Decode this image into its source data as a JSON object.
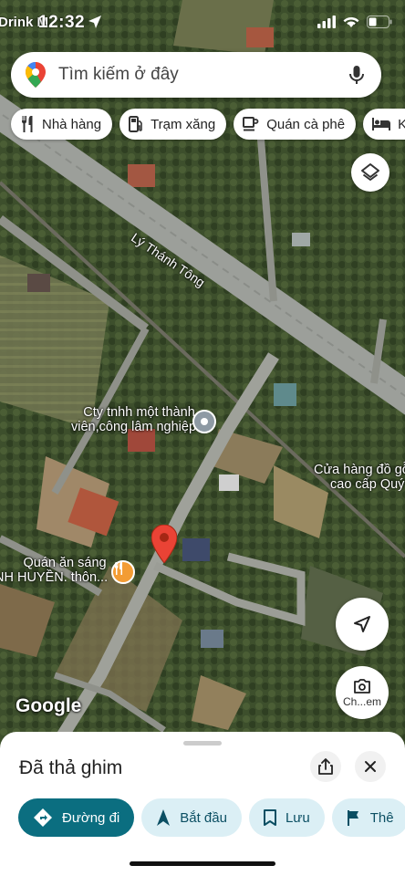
{
  "status_bar": {
    "carrier": "Drink M",
    "time": "12:32"
  },
  "search": {
    "placeholder": "Tìm kiếm ở đây"
  },
  "chips": [
    {
      "label": "Nhà hàng",
      "icon": "fork-knife-icon"
    },
    {
      "label": "Trạm xăng",
      "icon": "gas-station-icon"
    },
    {
      "label": "Quán cà phê",
      "icon": "coffee-cup-icon"
    },
    {
      "label": "Kh",
      "icon": "bed-icon"
    }
  ],
  "map": {
    "road_label": "Lý Thánh Tông",
    "poi_1": {
      "line1": "Cty tnhh một thành",
      "line2": "viên,công lâm nghiệp..."
    },
    "poi_2": {
      "line1": "Cửa hàng đồ gỗ",
      "line2": "cao cấp Quý"
    },
    "poi_3": {
      "line1": "Quán ăn sáng",
      "line2": "NH HUYỀN. thôn..."
    },
    "attribution": "Google",
    "chat_label": "Ch...em"
  },
  "sheet": {
    "title": "Đã thả ghim",
    "actions": [
      {
        "label": "Đường đi",
        "icon": "directions-icon"
      },
      {
        "label": "Bắt đầu",
        "icon": "navigation-arrow-icon"
      },
      {
        "label": "Lưu",
        "icon": "bookmark-icon"
      },
      {
        "label": "Thê",
        "icon": "flag-icon"
      }
    ]
  },
  "colors": {
    "primary": "#0b6e80",
    "secondary_bg": "#dbeff5",
    "pin": "#ea4335",
    "poi_orange": "#f39c34",
    "poi_gray": "#8e9aa4"
  }
}
